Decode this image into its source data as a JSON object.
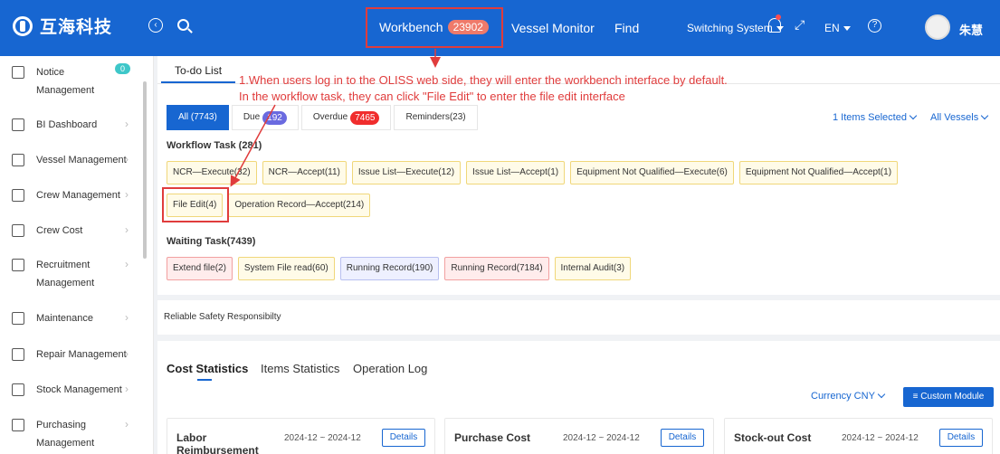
{
  "header": {
    "brand": "互海科技",
    "workbench_label": "Workbench",
    "workbench_count": "23902",
    "vessel_monitor": "Vessel Monitor",
    "find": "Find",
    "switching_system": "Switching System",
    "lang": "EN",
    "username": "朱慧"
  },
  "sidebar": {
    "items": [
      {
        "label_1": "Notice",
        "label_2": "Management",
        "badge": "0",
        "icon": "notice-icon"
      },
      {
        "label_1": "BI Dashboard",
        "icon": "chart-icon"
      },
      {
        "label_1": "Vessel Management",
        "icon": "anchor-icon"
      },
      {
        "label_1": "Crew Management",
        "icon": "person-icon"
      },
      {
        "label_1": "Crew Cost",
        "icon": "wallet-icon"
      },
      {
        "label_1": "Recruitment",
        "label_2": "Management",
        "icon": "recruit-icon"
      },
      {
        "label_1": "Maintenance",
        "icon": "wrench-icon"
      },
      {
        "label_1": "Repair Management",
        "icon": "repair-icon"
      },
      {
        "label_1": "Stock Management",
        "icon": "home-icon"
      },
      {
        "label_1": "Purchasing",
        "label_2": "Management",
        "icon": "cart-icon"
      }
    ]
  },
  "todo": {
    "tab": "To-do List",
    "annotation_line1": "1.When users log in to the OLISS web side, they will enter the workbench interface by default.",
    "annotation_line2": "In the workflow task, they can click \"File Edit\" to enter the file edit interface",
    "filters": {
      "all": "All (7743)",
      "due": "Due",
      "due_count": "192",
      "overdue": "Overdue",
      "overdue_count": "7465",
      "reminders": "Reminders(23)"
    },
    "items_selected": "1 Items Selected",
    "all_vessels": "All Vessels",
    "workflow_title": "Workflow Task (281)",
    "workflow_row1": [
      "NCR—Execute(32)",
      "NCR—Accept(11)",
      "Issue List—Execute(12)",
      "Issue List—Accept(1)",
      "Equipment Not Qualified—Execute(6)",
      "Equipment Not Qualified—Accept(1)"
    ],
    "workflow_row2": [
      "File Edit(4)",
      "Operation Record—Accept(214)"
    ],
    "waiting_title": "Waiting Task(7439)",
    "waiting": [
      "Extend file(2)",
      "System File read(60)",
      "Running Record(190)",
      "Running Record(7184)",
      "Internal Audit(3)"
    ]
  },
  "reliable": "Reliable Safety Responsibilty",
  "stats": {
    "tabs": [
      "Cost Statistics",
      "Items Statistics",
      "Operation Log"
    ],
    "currency": "Currency CNY",
    "custom_module": "Custom Module",
    "cards": [
      {
        "title": "Labor Reimbursement",
        "from": "2024-12",
        "to": "2024-12",
        "details": "Details"
      },
      {
        "title": "Purchase Cost",
        "from": "2024-12",
        "to": "2024-12",
        "details": "Details"
      },
      {
        "title": "Stock-out Cost",
        "from": "2024-12",
        "to": "2024-12",
        "details": "Details"
      }
    ],
    "tilde": "~"
  },
  "colors": {
    "brand": "#1766d1",
    "annotation": "#e03c3c"
  }
}
